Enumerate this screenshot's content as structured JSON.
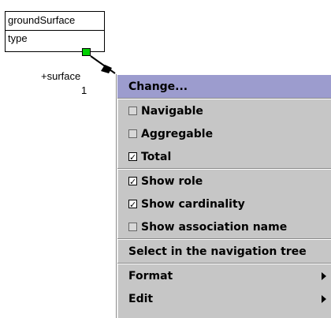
{
  "diagram": {
    "class_name": "groundSurface",
    "attribute": "type",
    "role_label": "+surface",
    "multiplicity": "1",
    "handle_color": "#00d000"
  },
  "context_menu": {
    "highlight_color": "#9c9cce",
    "background_color": "#c6c6c6",
    "groups": [
      [
        {
          "label": "Change...",
          "highlighted": true
        }
      ],
      [
        {
          "label": "Navigable",
          "checked": false
        },
        {
          "label": "Aggregable",
          "checked": false
        },
        {
          "label": "Total",
          "checked": true
        }
      ],
      [
        {
          "label": "Show role",
          "checked": true
        },
        {
          "label": "Show cardinality",
          "checked": true
        },
        {
          "label": "Show association name",
          "checked": false
        }
      ],
      [
        {
          "label": "Select in the navigation tree"
        }
      ],
      [
        {
          "label": "Format",
          "submenu": true
        },
        {
          "label": "Edit",
          "submenu": true
        }
      ]
    ],
    "check_glyph": "☑",
    "check_icon_name": "checkbox-icon",
    "submenu_icon_name": "submenu-arrow-icon"
  }
}
